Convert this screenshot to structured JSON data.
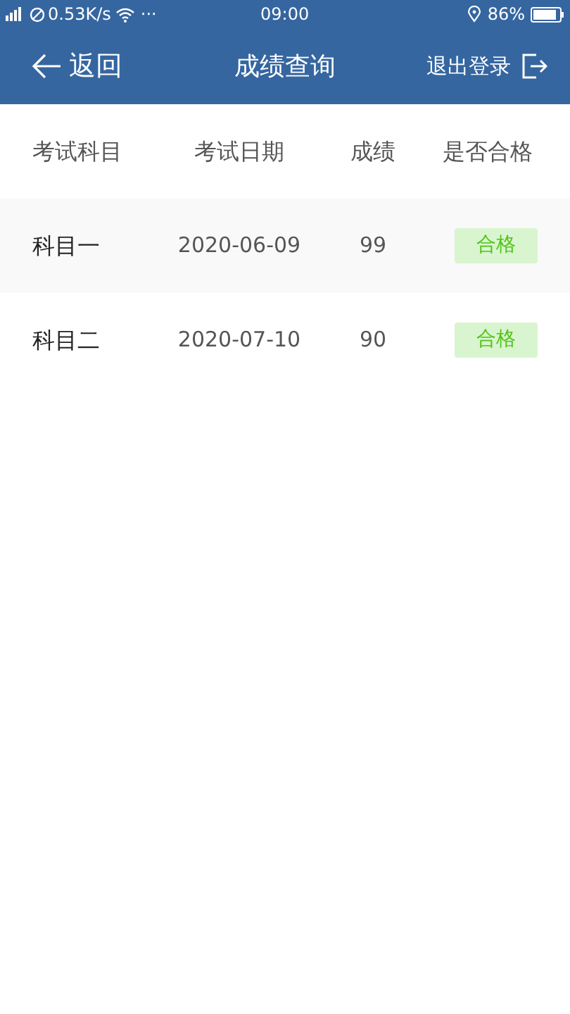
{
  "status_bar": {
    "speed": "0.53K/s",
    "more": "···",
    "time": "09:00",
    "battery": "86%"
  },
  "nav_bar": {
    "back": "返回",
    "title": "成绩查询",
    "logout": "退出登录"
  },
  "table": {
    "columns": [
      "考试科目",
      "考试日期",
      "成绩",
      "是否合格"
    ],
    "rows": [
      {
        "subject": "科目一",
        "date": "2020-06-09",
        "score": "99",
        "result": {
          "text": "合格",
          "kind": "pass"
        }
      },
      {
        "subject": "科目二",
        "date": "2020-07-10",
        "score": "90",
        "result": {
          "text": "合格",
          "kind": "pass"
        }
      }
    ]
  }
}
